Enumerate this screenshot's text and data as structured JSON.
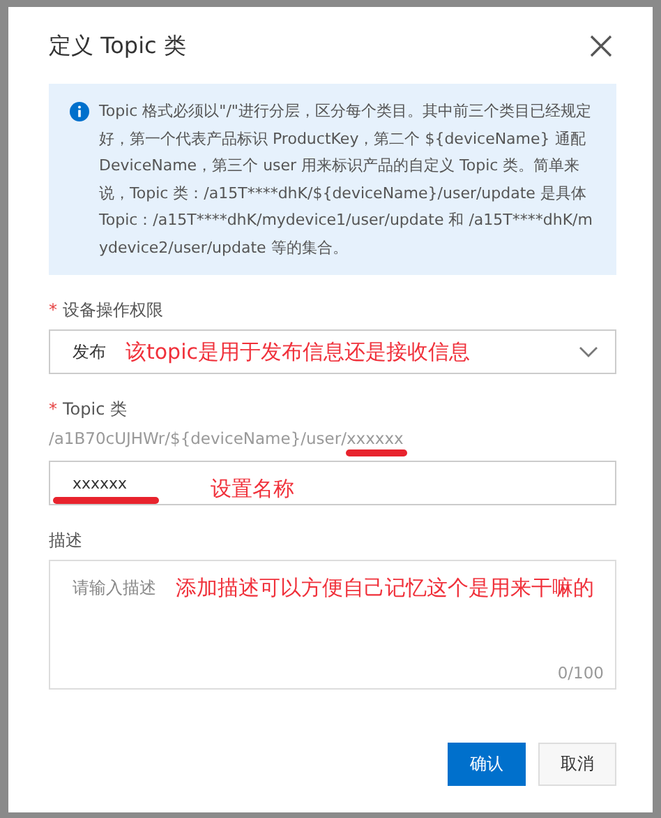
{
  "dialog": {
    "title": "定义 Topic 类",
    "info": "Topic 格式必须以\"/\"进行分层，区分每个类目。其中前三个类目已经规定好，第一个代表产品标识 ProductKey，第二个 ${deviceName} 通配 DeviceName，第三个 user 用来标识产品的自定义 Topic 类。简单来说，Topic 类：/a15T****dhK/${deviceName}/user/update 是具体 Topic：/a15T****dhK/mydevice1/user/update 和 /a15T****dhK/mydevice2/user/update 等的集合。"
  },
  "permission": {
    "label": "设备操作权限",
    "required_mark": "*",
    "value": "发布",
    "annotation": "该topic是用于发布信息还是接收信息"
  },
  "topic": {
    "label": "Topic 类",
    "required_mark": "*",
    "prefix": "/a1B70cUJHWr/${deviceName}/user/",
    "prefix_tail": "xxxxxx",
    "value": "xxxxxx",
    "annotation": "设置名称"
  },
  "description": {
    "label": "描述",
    "placeholder": "请输入描述",
    "counter": "0/100",
    "annotation": "添加描述可以方便自己记忆这个是用来干嘛的"
  },
  "buttons": [
    {
      "label": "确认",
      "kind": "primary"
    },
    {
      "label": "取消",
      "kind": "secondary"
    }
  ]
}
